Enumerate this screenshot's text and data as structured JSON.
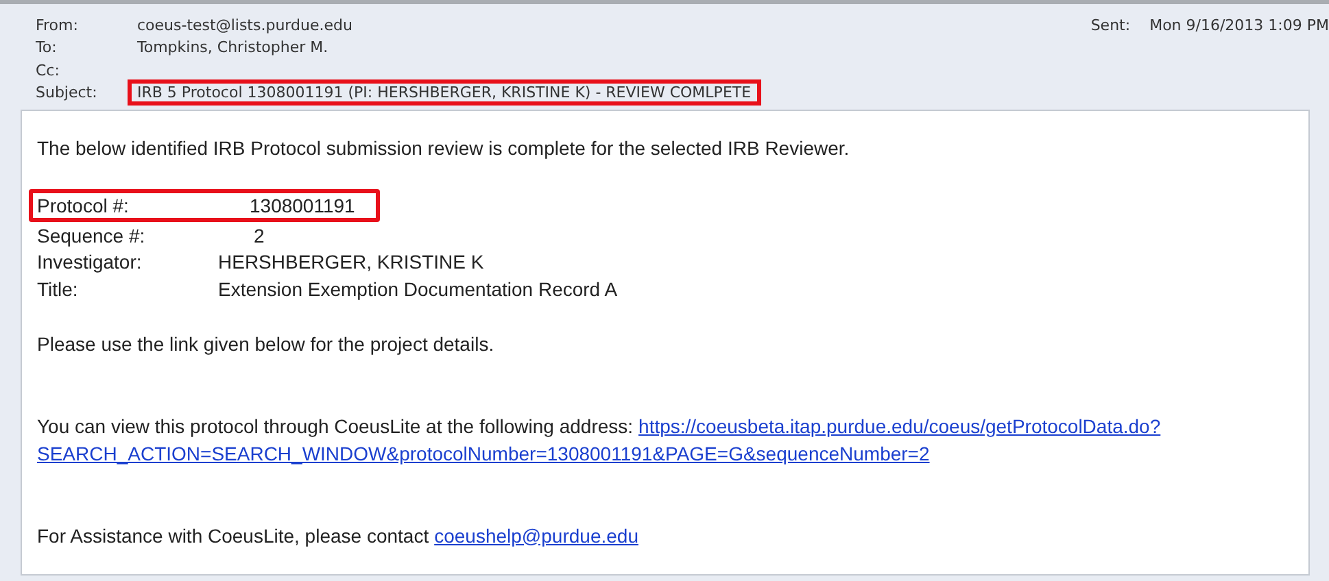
{
  "header": {
    "fields": [
      {
        "label": "From:",
        "value": "coeus-test@lists.purdue.edu",
        "highlighted": false
      },
      {
        "label": "To:",
        "value": "Tompkins, Christopher M.",
        "highlighted": false
      },
      {
        "label": "Cc:",
        "highlighted": false
      },
      {
        "label": "Subject:",
        "value": "IRB 5 Protocol 1308001191 (PI: HERSHBERGER, KRISTINE K) - REVIEW COMLPETE",
        "highlighted": true
      }
    ],
    "sent": {
      "label": "Sent:",
      "value": "Mon 9/16/2013 1:09 PM"
    }
  },
  "body": {
    "intro": "The below identified IRB Protocol submission review is complete for the selected IRB Reviewer.",
    "details": [
      {
        "label": "Protocol #:",
        "value": "1308001191",
        "highlighted": true
      },
      {
        "label": "Sequence #:",
        "value": "2",
        "highlighted": false
      },
      {
        "label": "Investigator:",
        "value": "HERSHBERGER, KRISTINE K",
        "highlighted": false
      },
      {
        "label": "Title:",
        "value": "Extension Exemption Documentation Record A",
        "highlighted": false
      }
    ],
    "note": "Please use the link given below for the project details.",
    "view_text": "You can view this protocol through CoeusLite at the following address:",
    "view_link_lines": [
      "https://coeusbeta.itap.purdue.edu/coeus/getProtocolData.do?",
      "SEARCH_ACTION=SEARCH_WINDOW&protocolNumber=1308001191&PAGE=G&sequenceNumber=2"
    ],
    "help_text": "For Assistance with CoeusLite, please contact",
    "help_link": "coeushelp@purdue.edu"
  }
}
